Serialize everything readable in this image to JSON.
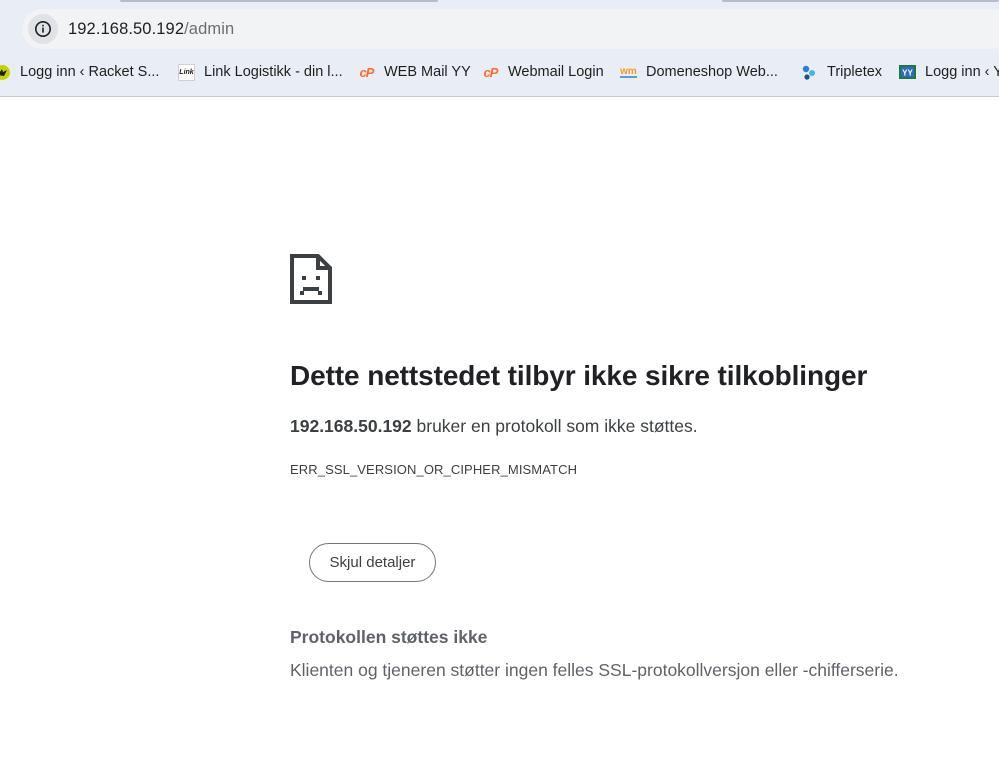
{
  "omnibox": {
    "host": "192.168.50.192",
    "path": "/admin"
  },
  "bookmarks": [
    {
      "label": "Logg inn ‹ Racket S...",
      "icon": "racket-favicon"
    },
    {
      "label": "Link Logistikk - din l...",
      "icon": "link-logistikk-favicon",
      "icon_text": "Link"
    },
    {
      "label": "WEB Mail YY",
      "icon": "cpanel-favicon",
      "icon_text": "cP"
    },
    {
      "label": "Webmail Login",
      "icon": "cpanel-favicon",
      "icon_text": "cP"
    },
    {
      "label": "Domeneshop Web...",
      "icon": "webmail-favicon",
      "icon_text": "wm"
    },
    {
      "label": "Tripletex",
      "icon": "tripletex-favicon"
    },
    {
      "label": "Logg inn ‹ Y",
      "icon": "yy-favicon"
    }
  ],
  "error": {
    "title": "Dette nettstedet tilbyr ikke sikre tilkoblinger",
    "host": "192.168.50.192",
    "summary_rest": " bruker en protokoll som ikke støttes.",
    "code": "ERR_SSL_VERSION_OR_CIPHER_MISMATCH",
    "details_button": "Skjul detaljer",
    "details_title": "Protokollen støttes ikke",
    "details_text": "Klienten og tjeneren støtter ingen felles SSL-protokollversjon eller -chifferserie."
  },
  "colors": {
    "chrome_bg": "#e9eef6",
    "cpanel_orange": "#ff6c2c",
    "text": "#202124",
    "muted": "#5f6368"
  }
}
